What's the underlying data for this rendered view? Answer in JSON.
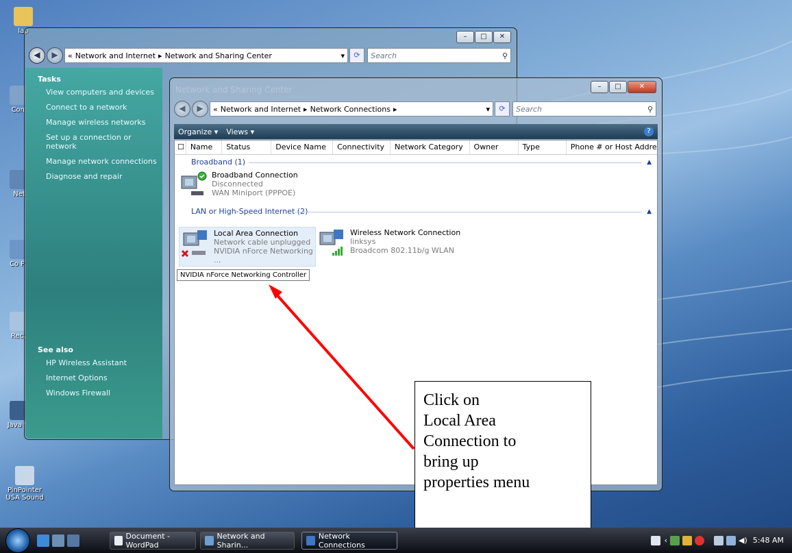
{
  "desktop": {
    "icons": [
      "lap",
      "Com",
      "Net",
      "Co Pa",
      "Recy",
      "Java St",
      "PinPointer USA Sound"
    ]
  },
  "back_window": {
    "breadcrumb_prefix": "«",
    "breadcrumb": [
      "Network and Internet",
      "Network and Sharing Center"
    ],
    "search_placeholder": "Search",
    "tasks_heading": "Tasks",
    "tasks": [
      "View computers and devices",
      "Connect to a network",
      "Manage wireless networks",
      "Set up a connection or network",
      "Manage network connections",
      "Diagnose and repair"
    ],
    "see_also_heading": "See also",
    "see_also": [
      "HP Wireless Assistant",
      "Internet Options",
      "Windows Firewall"
    ]
  },
  "front_window": {
    "title": "Network and Sharing Center",
    "breadcrumb_prefix": "«",
    "breadcrumb": [
      "Network and Internet",
      "Network Connections"
    ],
    "search_placeholder": "Search",
    "toolbar": {
      "organize": "Organize ▾",
      "views": "Views ▾"
    },
    "columns": [
      "Name",
      "Status",
      "Device Name",
      "Connectivity",
      "Network Category",
      "Owner",
      "Type",
      "Phone # or Host Addre..."
    ],
    "groups": [
      {
        "label": "Broadband (1)"
      },
      {
        "label": "LAN or High-Speed Internet (2)"
      }
    ],
    "items": {
      "broadband": {
        "name": "Broadband Connection",
        "status": "Disconnected",
        "device": "WAN Miniport (PPPOE)"
      },
      "lan": {
        "name": "Local Area Connection",
        "status": "Network cable unplugged",
        "device": "NVIDIA nForce Networking ..."
      },
      "wireless": {
        "name": "Wireless Network Connection",
        "status": "linksys",
        "device": "Broadcom 802.11b/g WLAN"
      }
    },
    "tooltip": "NVIDIA nForce Networking Controller"
  },
  "callout": {
    "lines": [
      "Click on",
      "Local Area",
      "Connection to",
      "bring up",
      "properties menu"
    ]
  },
  "taskbar": {
    "tasks": [
      "Document - WordPad",
      "Network and Sharin...",
      "Network Connections"
    ],
    "clock": "5:48 AM"
  },
  "colors": {
    "arrow": "#ff0000",
    "tasks_pane": "#2d7f7d",
    "group_text": "#1e3f9a"
  }
}
